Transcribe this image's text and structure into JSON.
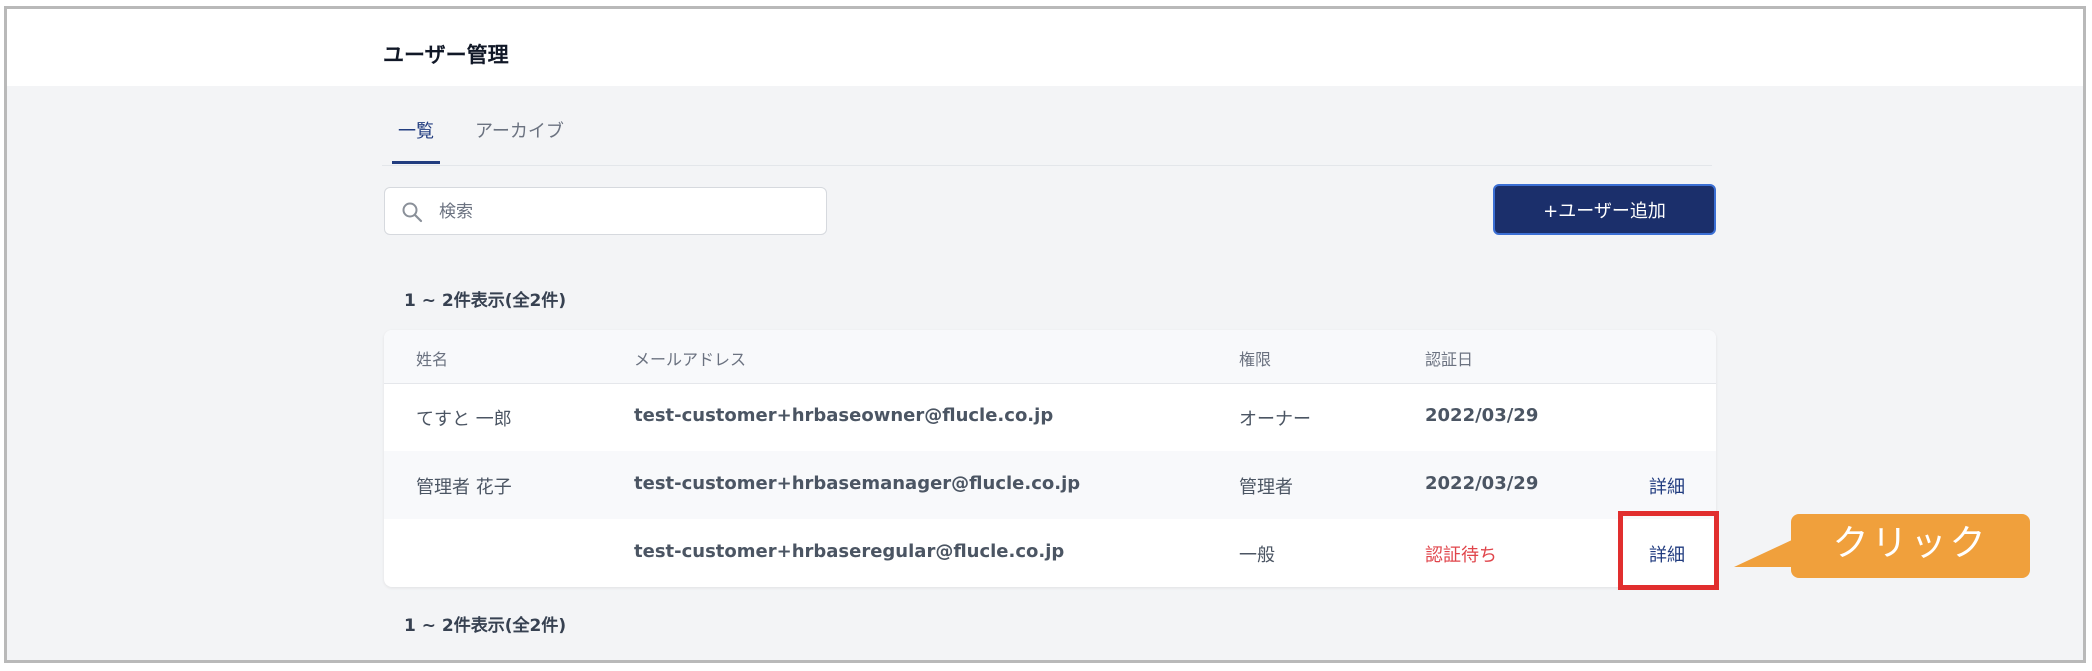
{
  "header": {
    "title": "ユーザー管理"
  },
  "tabs": [
    {
      "label": "一覧",
      "active": true
    },
    {
      "label": "アーカイブ",
      "active": false
    }
  ],
  "search": {
    "placeholder": "検索",
    "value": ""
  },
  "actions": {
    "add_user_label": "+ユーザー追加"
  },
  "pagination": {
    "count_text_top": "1 ~ 2件表示(全2件)",
    "count_text_bottom": "1 ~ 2件表示(全2件)"
  },
  "table": {
    "columns": [
      "姓名",
      "メールアドレス",
      "権限",
      "認証日"
    ],
    "rows": [
      {
        "name": "てすと 一郎",
        "email": "test-customer+hrbaseowner@flucle.co.jp",
        "role": "オーナー",
        "auth_date": "2022/03/29",
        "detail_label": ""
      },
      {
        "name": "管理者 花子",
        "email": "test-customer+hrbasemanager@flucle.co.jp",
        "role": "管理者",
        "auth_date": "2022/03/29",
        "detail_label": "詳細"
      },
      {
        "name": "",
        "email": "test-customer+hrbaseregular@flucle.co.jp",
        "role": "一般",
        "auth_date": "認証待ち",
        "detail_label": "詳細"
      }
    ]
  },
  "annotation": {
    "callout_text": "クリック"
  },
  "colors": {
    "primary": "#1b2f6b",
    "accent_link": "#223d80",
    "pending": "#e0454b",
    "highlight": "#e12e2e",
    "callout": "#f0a03c"
  }
}
